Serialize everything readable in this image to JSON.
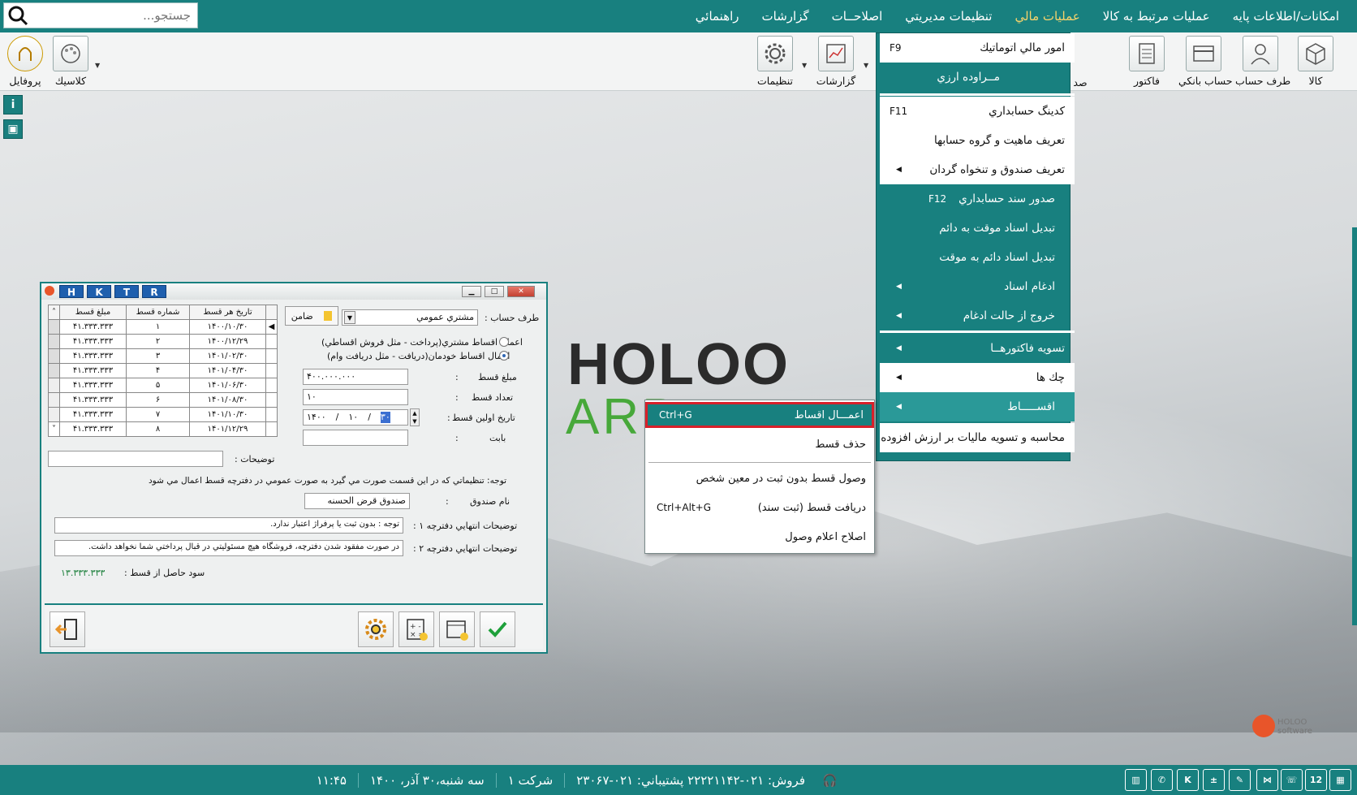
{
  "menubar": {
    "items": [
      "امكانات/اطلاعات پايه",
      "عمليات مرتبط به كالا",
      "عمليات مالي",
      "تنظيمات مديريتي",
      "اصلاحــات",
      "گزارشات",
      "راهنمائي"
    ],
    "active_index": 2
  },
  "search": {
    "placeholder": "جستجو..."
  },
  "toolbar": {
    "right": [
      "كالا",
      "طرف حساب",
      "حساب بانكي",
      "فاكتور",
      "صد"
    ],
    "left": [
      "تنظيمات",
      "گزارشات",
      "كلاسيك",
      "پروفايل"
    ]
  },
  "logo": {
    "main": "HOLOO",
    "sub": "ARP",
    "corner": "HOLOO software"
  },
  "dropdown": {
    "auto": {
      "label": "امور مالي اتوماتيك",
      "shortcut": "F9"
    },
    "currency": {
      "label": "مــراوده ارزي"
    },
    "coding": {
      "label": "كدينگ حسابداري",
      "shortcut": "F11"
    },
    "nature": {
      "label": "تعريف ماهيت و گروه حسابها"
    },
    "fund": {
      "label": "تعريف صندوق و تنخواه گردان"
    },
    "voucher": {
      "label": "صدور سند حسابداري",
      "shortcut": "F12"
    },
    "temp2perm": {
      "label": "تبديل اسناد موقت به دائم"
    },
    "perm2temp": {
      "label": "تبديل اسناد دائم به موقت"
    },
    "merge": {
      "label": "ادغام اسناد"
    },
    "unmerge": {
      "label": "خروج از حالت ادغام"
    },
    "settle": {
      "label": "تسويه فاكتورهــا"
    },
    "cheques": {
      "label": "چك ها"
    },
    "installments": {
      "label": "اقســـــاط"
    },
    "vat": {
      "label": "محاسبه و تسويه ماليات بر ارزش افزوده"
    }
  },
  "submenu": {
    "apply": {
      "label": "اعمـــال اقساط",
      "shortcut": "Ctrl+G"
    },
    "delete": {
      "label": "حذف قسط"
    },
    "receive_no_voucher": {
      "label": "وصول قسط بدون ثبت در معين شخص"
    },
    "receive_voucher": {
      "label": "دريافت قسط (ثبت سند)",
      "shortcut": "Ctrl+Alt+G"
    },
    "fix_notice": {
      "label": "اصلاح اعلام وصول"
    }
  },
  "window": {
    "keys": [
      "H",
      "K",
      "T",
      "R"
    ],
    "grid": {
      "headers": [
        "تاريخ هر قسط",
        "شماره قسط",
        "مبلغ قسط"
      ],
      "rows": [
        [
          "۱۴۰۰/۱۰/۳۰",
          "۱",
          "۴۱.۳۳۳.۳۳۳"
        ],
        [
          "۱۴۰۰/۱۲/۲۹",
          "۲",
          "۴۱.۳۳۳.۳۳۳"
        ],
        [
          "۱۴۰۱/۰۲/۳۰",
          "۳",
          "۴۱.۳۳۳.۳۳۳"
        ],
        [
          "۱۴۰۱/۰۴/۳۰",
          "۴",
          "۴۱.۳۳۳.۳۳۳"
        ],
        [
          "۱۴۰۱/۰۶/۳۰",
          "۵",
          "۴۱.۳۳۳.۳۳۳"
        ],
        [
          "۱۴۰۱/۰۸/۳۰",
          "۶",
          "۴۱.۳۳۳.۳۳۳"
        ],
        [
          "۱۴۰۱/۱۰/۳۰",
          "۷",
          "۴۱.۳۳۳.۳۳۳"
        ],
        [
          "۱۴۰۱/۱۲/۲۹",
          "۸",
          "۴۱.۳۳۳.۳۳۳"
        ]
      ]
    },
    "account_label": "طرف حساب :",
    "account_value": "مشتري عمومي",
    "guarantor_btn": "ضامن",
    "radio1": "اعمال اقساط مشتري(پرداخت - مثل فروش اقساطي)",
    "radio2": "اعمال اقساط خودمان(دريافت - مثل دريافت وام)",
    "amount_label": "مبلغ قسط",
    "amount_value": "۴۰۰.۰۰۰.۰۰۰",
    "count_label": "تعداد قسط",
    "count_value": "۱۰",
    "first_date_label": "تاريخ اولين قسط",
    "date_y": "۱۴۰۰",
    "date_m": "۱۰",
    "date_d": "۳۰",
    "for_label": "بابت",
    "desc_label": "توضيحات :",
    "note": "توجه:  تنظيماتي كه در اين قسمت صورت مي گيرد به صورت عمومي در دفترچه قسط اعمال مي شود",
    "fund_label": "نام صندوق",
    "fund_value": "صندوق قرض الحسنه",
    "end1_label": "توضيحات انتهايي دفترچه ۱ :",
    "end1_value": "توجه : بدون ثبت يا پرفراژ اعتبار ندارد.",
    "end2_label": "توضيحات انتهايي دفترچه ۲ :",
    "end2_value": "در صورت مفقود شدن دفترچه، فروشگاه هيچ مسئوليتي در قبال پرداختي شما نخواهد داشت.",
    "profit_label": "سود حاصل از قسط :",
    "profit_value": "۱۳.۳۳۳.۳۳۳"
  },
  "status": {
    "sales": "فروش:  ۰۲۱-۲۲۲۲۱۱۴۲  پشتيباني: ۰۲۱-۲۳۰۶۷",
    "company": "شركت ۱",
    "date": "سه شنبه،۳۰ آذر، ۱۴۰۰",
    "time": "۱۱:۴۵",
    "calendar_day": "12"
  }
}
